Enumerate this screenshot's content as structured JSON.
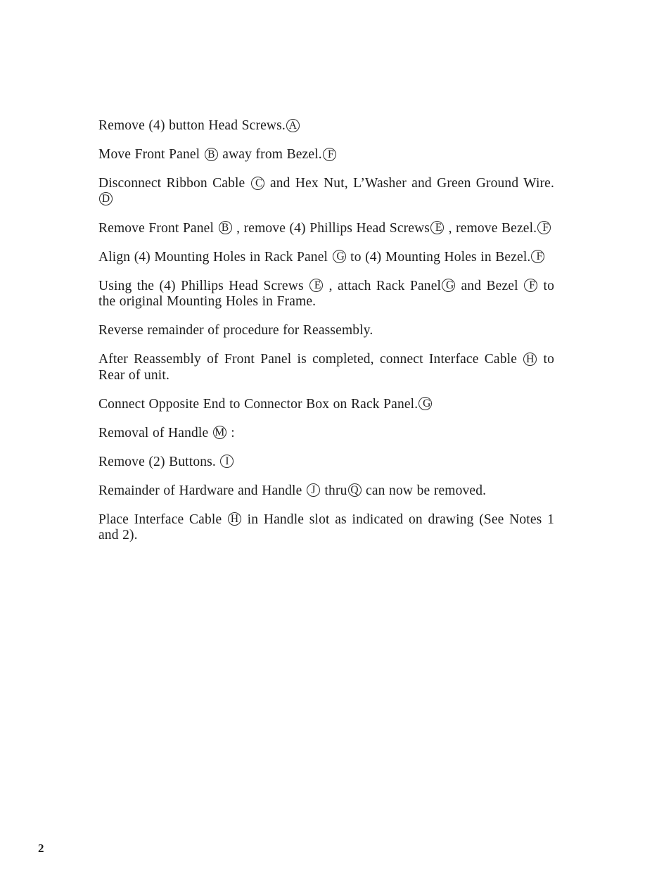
{
  "document": {
    "page_number": "2",
    "paragraphs": [
      {
        "id": "p1",
        "segments": [
          {
            "type": "text",
            "value": "Remove (4) button Head Screws."
          },
          {
            "type": "circled",
            "value": "A"
          }
        ]
      },
      {
        "id": "p2",
        "segments": [
          {
            "type": "text",
            "value": "Move Front Panel "
          },
          {
            "type": "circled",
            "value": "B"
          },
          {
            "type": "text",
            "value": " away from Bezel."
          },
          {
            "type": "circled",
            "value": "F"
          }
        ]
      },
      {
        "id": "p3",
        "segments": [
          {
            "type": "text",
            "value": "Disconnect Ribbon Cable "
          },
          {
            "type": "circled",
            "value": "C"
          },
          {
            "type": "text",
            "value": " and Hex Nut, L’Washer and Green Ground Wire."
          },
          {
            "type": "circled",
            "value": "D"
          }
        ]
      },
      {
        "id": "p4",
        "segments": [
          {
            "type": "text",
            "value": "Remove Front Panel "
          },
          {
            "type": "circled",
            "value": "B"
          },
          {
            "type": "text",
            "value": " , remove (4) Phillips Head Screws"
          },
          {
            "type": "circled",
            "value": "E"
          },
          {
            "type": "text",
            "value": " , remove Bezel."
          },
          {
            "type": "circled",
            "value": "F"
          }
        ]
      },
      {
        "id": "p5",
        "segments": [
          {
            "type": "text",
            "value": "Align (4) Mounting Holes in Rack Panel "
          },
          {
            "type": "circled",
            "value": "G"
          },
          {
            "type": "text",
            "value": " to (4) Mounting Holes in Bezel."
          },
          {
            "type": "circled",
            "value": "F"
          }
        ]
      },
      {
        "id": "p6",
        "segments": [
          {
            "type": "text",
            "value": "Using the (4) Phillips Head Screws "
          },
          {
            "type": "circled",
            "value": "E"
          },
          {
            "type": "text",
            "value": " , attach Rack Panel"
          },
          {
            "type": "circled",
            "value": "G"
          },
          {
            "type": "text",
            "value": " and Bezel "
          },
          {
            "type": "circled",
            "value": "F"
          },
          {
            "type": "text",
            "value": " to the original Mounting Holes in Frame."
          }
        ]
      },
      {
        "id": "p7",
        "segments": [
          {
            "type": "text",
            "value": "Reverse remainder of procedure for Reassembly."
          }
        ]
      },
      {
        "id": "p8",
        "segments": [
          {
            "type": "text",
            "value": "After Reassembly of Front Panel is completed, connect Interface Cable "
          },
          {
            "type": "circled",
            "value": "H"
          },
          {
            "type": "text",
            "value": " to Rear of unit."
          }
        ]
      },
      {
        "id": "p9",
        "segments": [
          {
            "type": "text",
            "value": "Connect Opposite End to Connector Box on Rack Panel."
          },
          {
            "type": "circled",
            "value": "G"
          }
        ]
      },
      {
        "id": "p10",
        "segments": [
          {
            "type": "text",
            "value": "Removal of Handle "
          },
          {
            "type": "circled",
            "value": "M"
          },
          {
            "type": "text",
            "value": " :"
          }
        ]
      },
      {
        "id": "p11",
        "segments": [
          {
            "type": "text",
            "value": "Remove (2) Buttons. "
          },
          {
            "type": "circled",
            "value": "I"
          }
        ]
      },
      {
        "id": "p12",
        "segments": [
          {
            "type": "text",
            "value": "Remainder of Hardware and Handle "
          },
          {
            "type": "circled",
            "value": "J"
          },
          {
            "type": "text",
            "value": " thru"
          },
          {
            "type": "circled",
            "value": "Q"
          },
          {
            "type": "text",
            "value": " can now be removed."
          }
        ]
      },
      {
        "id": "p13",
        "segments": [
          {
            "type": "text",
            "value": "Place Interface Cable "
          },
          {
            "type": "circled",
            "value": "H"
          },
          {
            "type": "text",
            "value": " in Handle slot as indicated on drawing (See Notes 1 and 2)."
          }
        ]
      }
    ]
  }
}
